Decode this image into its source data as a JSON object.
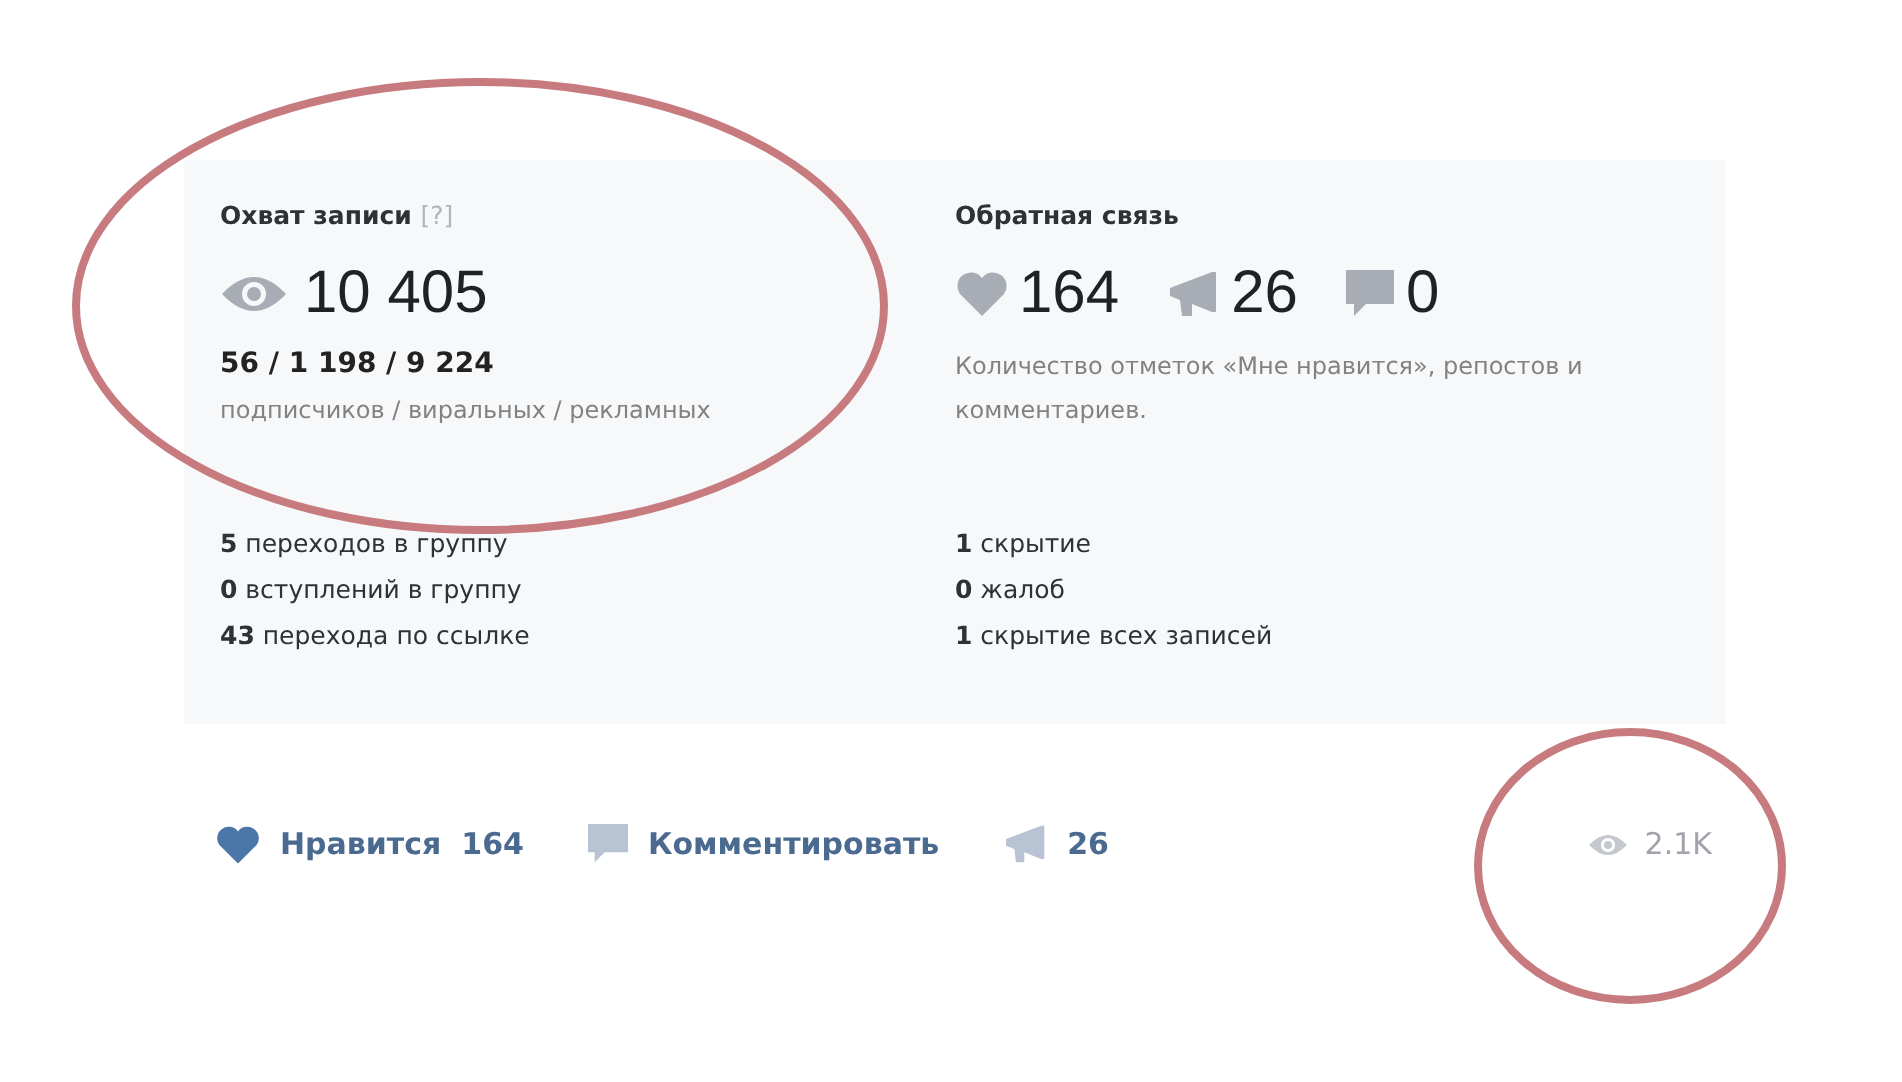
{
  "reach": {
    "title": "Охват записи",
    "help": "[?]",
    "total": "10 405",
    "breakdown": "56 / 1 198 / 9 224",
    "caption": "подписчиков / виральных / рекламных"
  },
  "feedback": {
    "title": "Обратная связь",
    "counters": [
      {
        "kind": "like",
        "value": "164"
      },
      {
        "kind": "repost",
        "value": "26"
      },
      {
        "kind": "comment",
        "value": "0"
      }
    ],
    "caption": "Количество отметок «Мне нравится», репостов и комментариев."
  },
  "group_stats": [
    {
      "count": "5",
      "label": "переходов в группу"
    },
    {
      "count": "0",
      "label": "вступлений в группу"
    },
    {
      "count": "43",
      "label": "перехода по ссылке"
    }
  ],
  "negative_stats": [
    {
      "count": "1",
      "label": "скрытие"
    },
    {
      "count": "0",
      "label": "жалоб"
    },
    {
      "count": "1",
      "label": "скрытие всех записей"
    }
  ],
  "actions": [
    {
      "kind": "like",
      "label": "Нравится",
      "count": "164",
      "liked": true
    },
    {
      "kind": "comment",
      "label": "Комментировать"
    },
    {
      "kind": "repost",
      "count": "26"
    }
  ],
  "views": "2.1K"
}
